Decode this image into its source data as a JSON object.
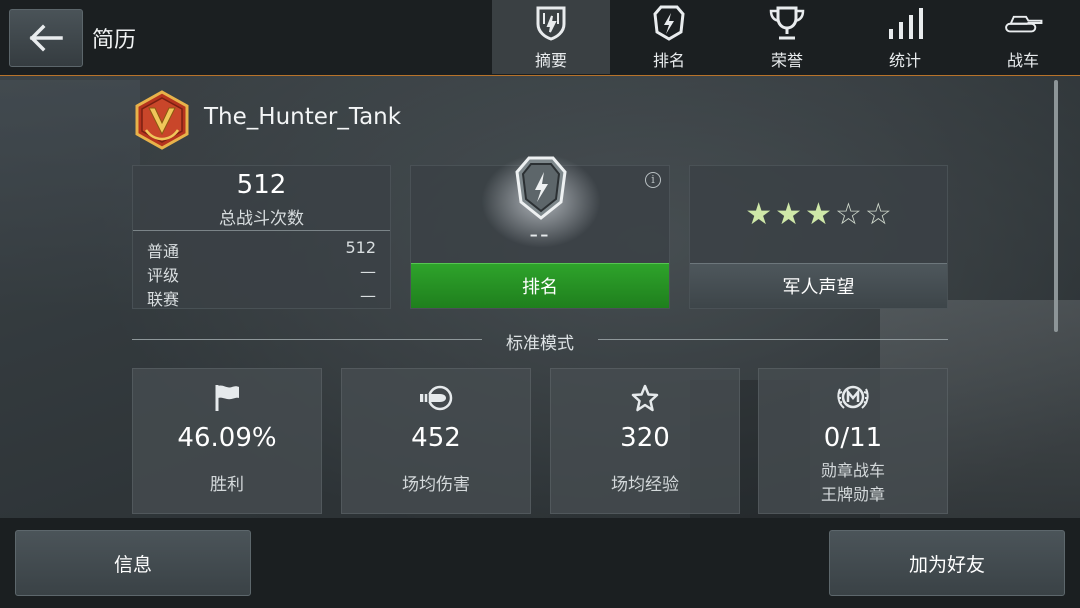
{
  "header": {
    "title": "简历",
    "tabs": [
      {
        "label": "摘要",
        "icon": "shield-summary-icon",
        "active": true
      },
      {
        "label": "排名",
        "icon": "shield-bolt-icon",
        "active": false
      },
      {
        "label": "荣誉",
        "icon": "trophy-icon",
        "active": false
      },
      {
        "label": "统计",
        "icon": "bar-chart-icon",
        "active": false
      },
      {
        "label": "战车",
        "icon": "tank-icon",
        "active": false
      }
    ]
  },
  "player": {
    "name": "The_Hunter_Tank",
    "badge_icon": "v-rank-badge-icon"
  },
  "battles": {
    "total": "512",
    "label": "总战斗次数",
    "rows": [
      {
        "label": "普通",
        "value": "512"
      },
      {
        "label": "评级",
        "value": "—"
      },
      {
        "label": "联赛",
        "value": "—"
      }
    ]
  },
  "rating": {
    "value": "--",
    "button_label": "排名"
  },
  "reputation": {
    "stars_filled": 3,
    "stars_total": 5,
    "button_label": "军人声望"
  },
  "section": {
    "title": "标准模式"
  },
  "stats": [
    {
      "icon": "flag-icon",
      "value": "46.09%",
      "label": "胜利"
    },
    {
      "icon": "shell-icon",
      "value": "452",
      "label": "场均伤害"
    },
    {
      "icon": "star-outline-icon",
      "value": "320",
      "label": "场均经验"
    },
    {
      "icon": "mastery-badge-icon",
      "value": "0/11",
      "label_line1": "勋章战车",
      "label_line2": "王牌勋章"
    }
  ],
  "bottom": {
    "info_label": "信息",
    "add_friend_label": "加为好友"
  },
  "colors": {
    "accent_orange": "#b8732a",
    "rating_green": "#2ea32b",
    "star_green": "#cfe8a8"
  }
}
